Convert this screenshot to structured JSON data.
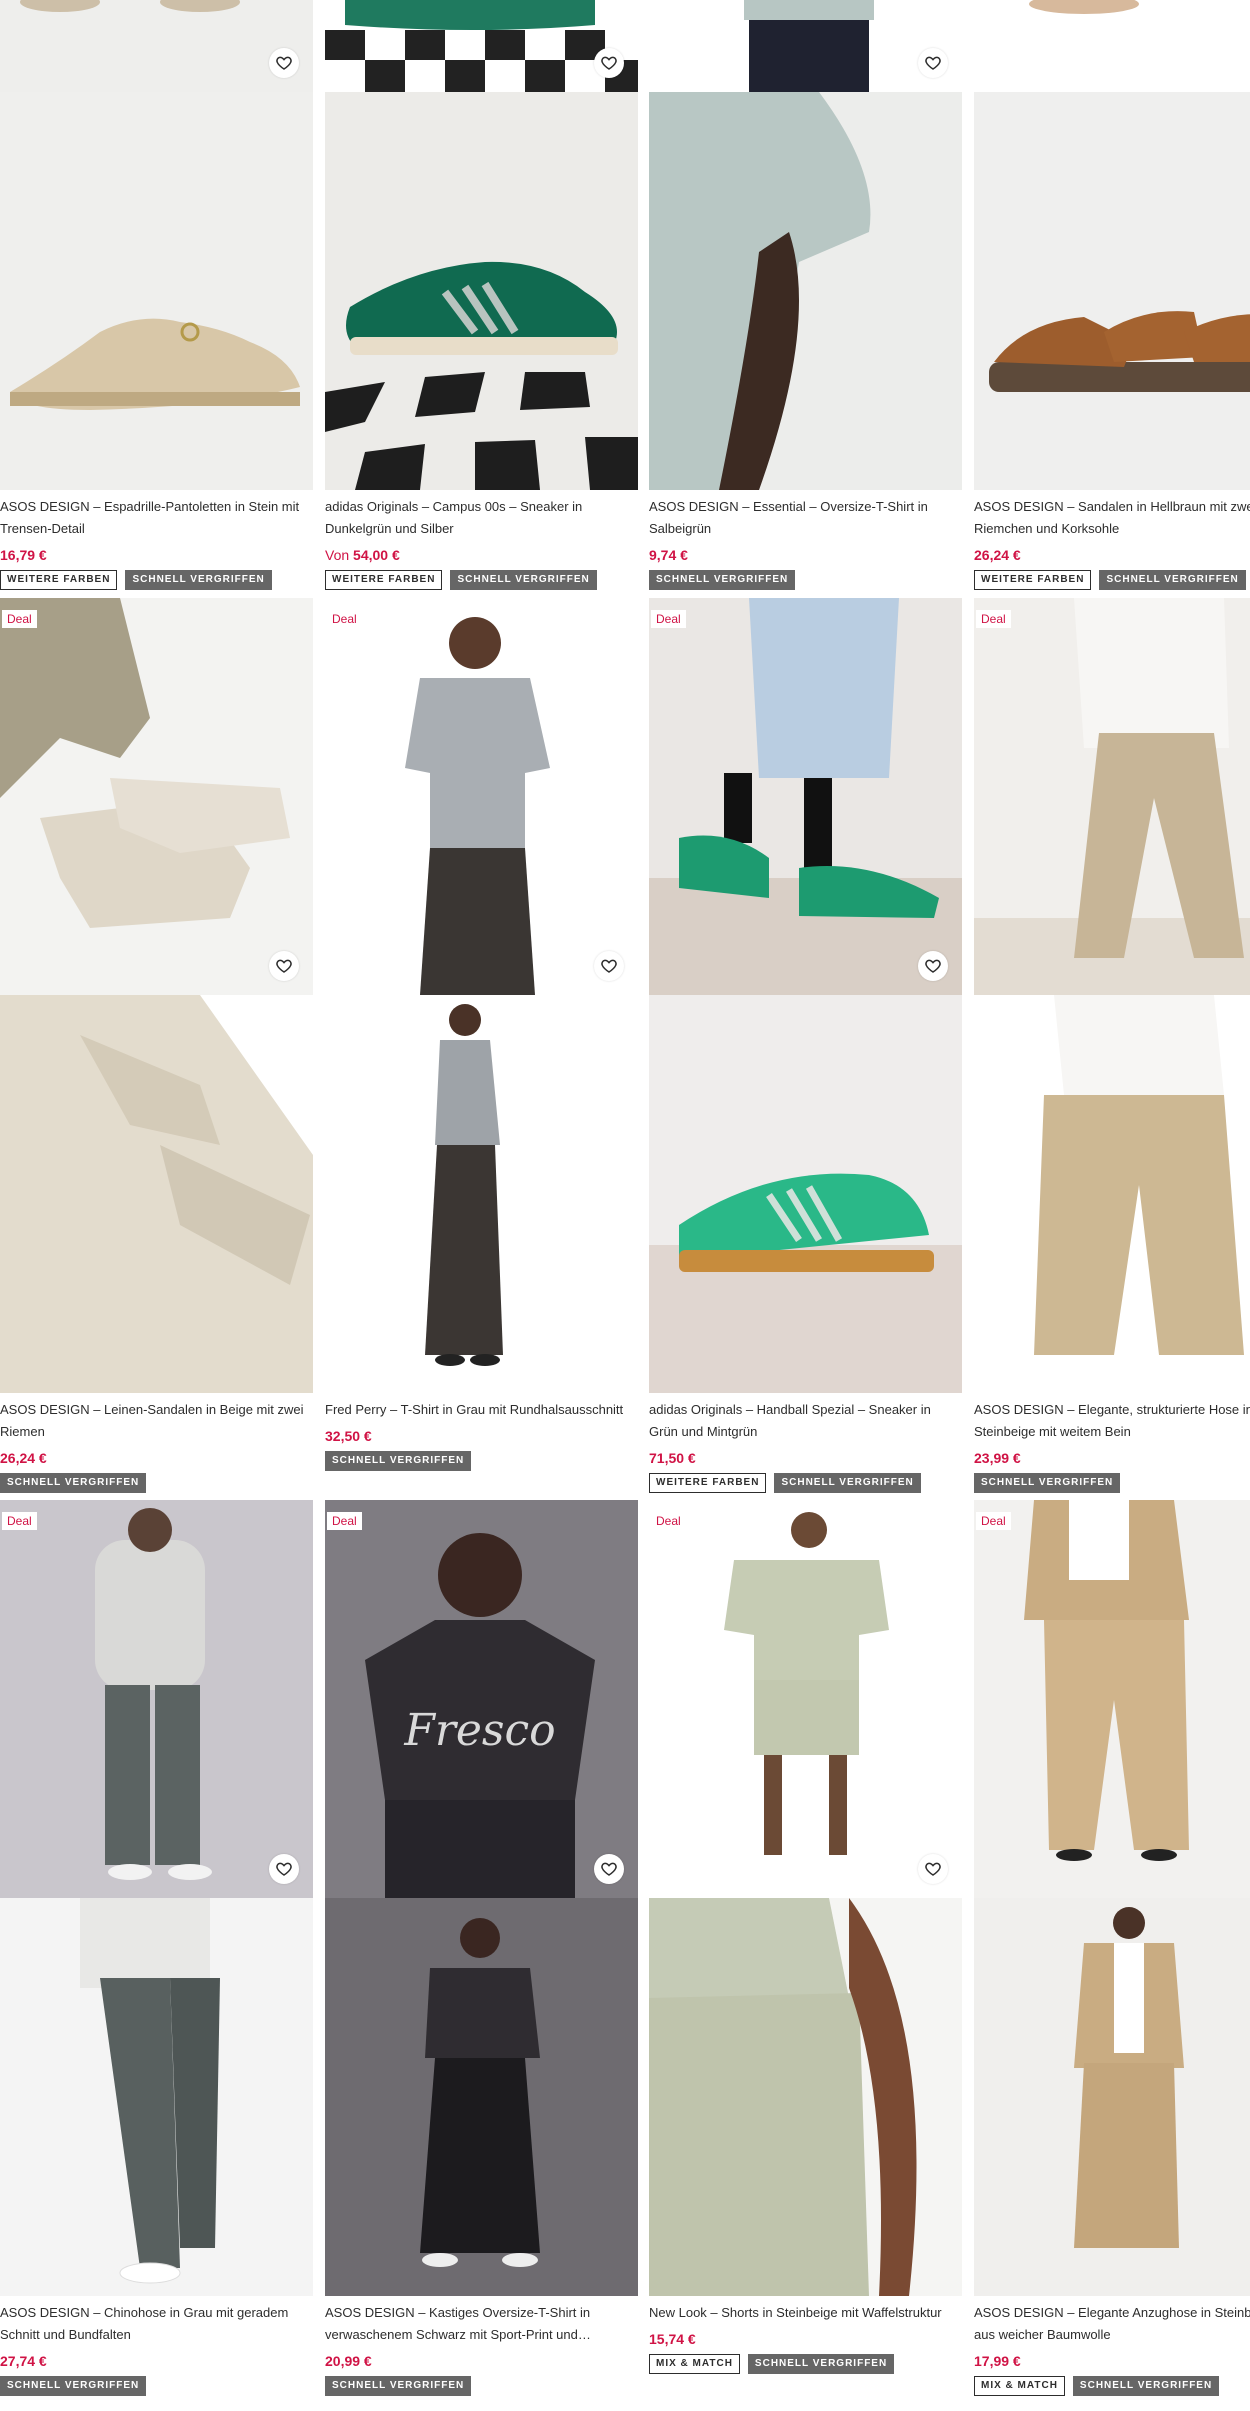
{
  "icons": {
    "wishlist": "heart-outline-icon"
  },
  "colors": {
    "price": "#d01345",
    "deal": "#d01345",
    "badge_solid": "#666666"
  },
  "badges": {
    "more_colors": "WEITERE FARBEN",
    "selling_fast": "SCHNELL VERGRIFFEN",
    "mix_match": "MIX & MATCH"
  },
  "deal_label": "Deal",
  "products": [
    {
      "title": "ASOS DESIGN – Espadrille-Pantoletten in Stein mit Trensen-Detail",
      "price_prefix": "",
      "price": "16,79 €"
    },
    {
      "title": "adidas Originals – Campus 00s – Sneaker in Dunkelgrün und Silber",
      "price_prefix": "Von ",
      "price": "54,00 €"
    },
    {
      "title": "ASOS DESIGN – Essential – Oversize-T-Shirt in Salbeigrün",
      "price_prefix": "",
      "price": "9,74 €"
    },
    {
      "title": "ASOS DESIGN – Sandalen in Hellbraun mit zwei Riemchen und Korksohle",
      "price_prefix": "",
      "price": "26,24 €"
    },
    {
      "title": "ASOS DESIGN – Leinen-Sandalen in Beige mit zwei Riemen",
      "price_prefix": "",
      "price": "26,24 €"
    },
    {
      "title": "Fred Perry – T-Shirt in Grau mit Rundhalsausschnitt",
      "price_prefix": "",
      "price": "32,50 €"
    },
    {
      "title": "adidas Originals – Handball Spezial – Sneaker in Grün und Mintgrün",
      "price_prefix": "",
      "price": "71,50 €"
    },
    {
      "title": "ASOS DESIGN – Elegante, strukturierte Hose in Steinbeige mit weitem Bein",
      "price_prefix": "",
      "price": "23,99 €"
    },
    {
      "title": "ASOS DESIGN – Chinohose in Grau mit geradem Schnitt und Bundfalten",
      "price_prefix": "",
      "price": "27,74 €"
    },
    {
      "title": "ASOS DESIGN – Kastiges Oversize-T-Shirt in verwaschenem Schwarz mit Sport-Print und…",
      "price_prefix": "",
      "price": "20,99 €"
    },
    {
      "title": "New Look – Shorts in Steinbeige mit Waffelstruktur",
      "price_prefix": "",
      "price": "15,74 €"
    },
    {
      "title": "ASOS DESIGN – Elegante Anzughose in Steinbeige aus weicher Baumwolle",
      "price_prefix": "",
      "price": "17,99 €"
    }
  ]
}
